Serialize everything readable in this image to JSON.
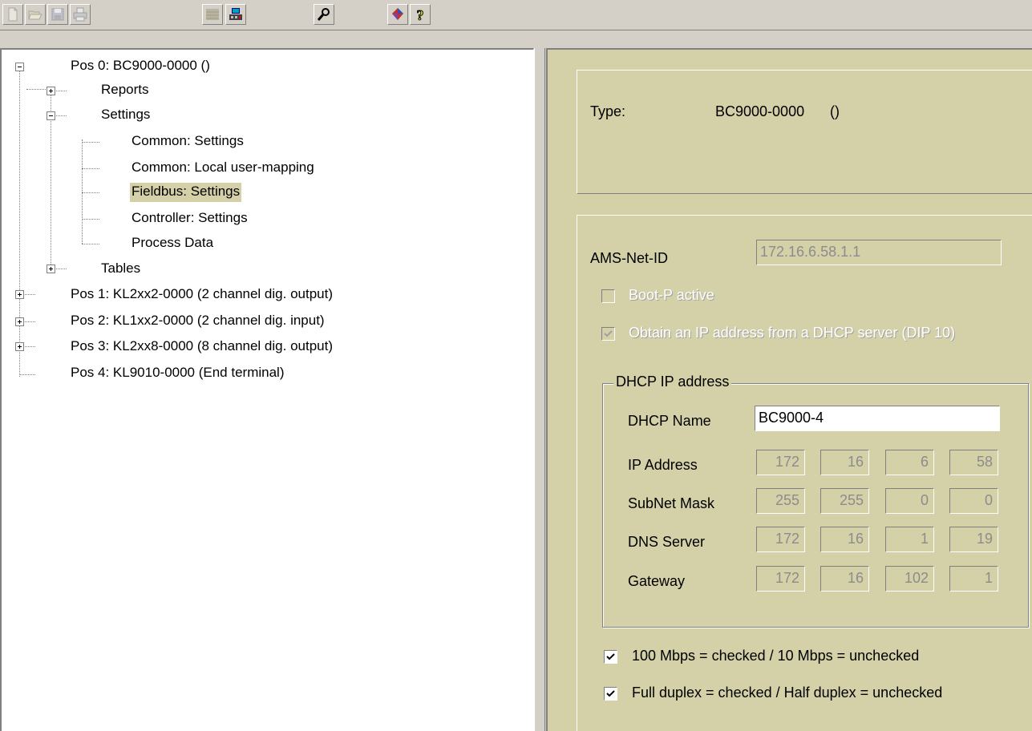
{
  "toolbar": {
    "buttons": [
      {
        "name": "new-icon",
        "enabled": false
      },
      {
        "name": "open-icon",
        "enabled": false
      },
      {
        "name": "save-icon",
        "enabled": false
      },
      {
        "name": "print-icon",
        "enabled": false
      },
      {
        "name": "disconnect-icon",
        "enabled": false
      },
      {
        "name": "connect-icon",
        "enabled": true
      },
      {
        "name": "settings-icon",
        "enabled": true
      },
      {
        "name": "about-icon",
        "enabled": true
      },
      {
        "name": "help-icon",
        "enabled": true
      }
    ]
  },
  "tree": {
    "root": "Pos 0: BC9000-0000  ()",
    "reports": "Reports",
    "settings": "Settings",
    "common_settings": "Common: Settings",
    "common_local_user_mapping": "Common: Local user-mapping",
    "fieldbus_settings": "Fieldbus: Settings",
    "controller_settings": "Controller: Settings",
    "process_data": "Process Data",
    "tables": "Tables",
    "pos1": "Pos 1: KL2xx2-0000  (2 channel dig. output)",
    "pos2": "Pos 2: KL1xx2-0000  (2 channel dig. input)",
    "pos3": "Pos 3: KL2xx8-0000  (8 channel dig. output)",
    "pos4": "Pos 4: KL9010-0000  (End terminal)",
    "selected": "fieldbus_settings"
  },
  "info": {
    "type_label": "Type:",
    "type_value": "BC9000-0000",
    "type_suffix": "()"
  },
  "settings": {
    "ams_net_id_label": "AMS-Net-ID",
    "ams_net_id_value": "172.16.6.58.1.1",
    "bootp_label": "Boot-P active",
    "bootp_checked": false,
    "dhcp_obtain_label": "Obtain an IP address from a DHCP server (DIP 10)",
    "dhcp_obtain_checked": true,
    "dhcp_group_label": "DHCP IP address",
    "dhcp_name_label": "DHCP Name",
    "dhcp_name_value": "BC9000-4",
    "ip_address_label": "IP Address",
    "ip_address": [
      "172",
      "16",
      "6",
      "58"
    ],
    "subnet_label": "SubNet Mask",
    "subnet": [
      "255",
      "255",
      "0",
      "0"
    ],
    "dns_label": "DNS Server",
    "dns": [
      "172",
      "16",
      "1",
      "19"
    ],
    "gateway_label": "Gateway",
    "gateway": [
      "172",
      "16",
      "102",
      "1"
    ],
    "speed_label": "100 Mbps = checked  / 10 Mbps = unchecked",
    "speed_checked": true,
    "duplex_label": "Full duplex = checked / Half duplex = unchecked",
    "duplex_checked": true
  }
}
